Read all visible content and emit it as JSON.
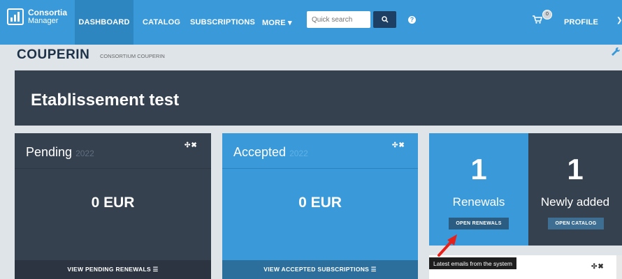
{
  "app": {
    "logo_line1": "Consortia",
    "logo_line2": "Manager"
  },
  "nav": {
    "dashboard": "DASHBOARD",
    "catalog": "CATALOG",
    "subscriptions": "SUBSCRIPTIONS",
    "more": "MORE ▾",
    "search_placeholder": "Quick search",
    "cart_count": "0",
    "profile": "PROFILE"
  },
  "org": {
    "name": "COUPERIN",
    "full_name": "CONSORTIUM COUPERIN"
  },
  "banner": {
    "title": "Etablissement test"
  },
  "pending": {
    "title": "Pending",
    "year": "2022",
    "amount": "0 EUR",
    "footer": "VIEW PENDING RENEWALS ☰"
  },
  "accepted": {
    "title": "Accepted",
    "year": "2022",
    "amount": "0 EUR",
    "footer": "VIEW ACCEPTED SUBSCRIPTIONS ☰"
  },
  "renewals": {
    "count": "1",
    "label": "Renewals",
    "button": "OPEN RENEWALS"
  },
  "newly": {
    "count": "1",
    "label": "Newly added",
    "button": "OPEN CATALOG"
  },
  "emails": {
    "tooltip": "Latest emails from the system"
  },
  "colors": {
    "brand_blue": "#3a9ad9",
    "dark_slate": "#36414f",
    "arrow_red": "#e8201a"
  }
}
